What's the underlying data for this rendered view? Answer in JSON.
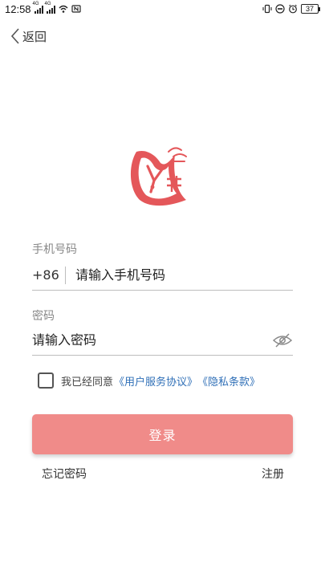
{
  "status_bar": {
    "time": "12:58",
    "network_1": "4G",
    "network_2": "4G",
    "battery": "37"
  },
  "nav": {
    "back_label": "返回"
  },
  "form": {
    "phone_label": "手机号码",
    "country_code": "+86",
    "phone_placeholder": "请输入手机号码",
    "password_label": "密码",
    "password_placeholder": "请输入密码"
  },
  "agreement": {
    "prefix": "我已经同意",
    "user_agreement": "《用户服务协议》",
    "privacy_policy": "《隐私条款》"
  },
  "actions": {
    "login": "登录",
    "forgot_password": "忘记密码",
    "register": "注册"
  },
  "colors": {
    "accent": "#f08b89",
    "logo": "#e4575a",
    "link": "#2f6fb7"
  }
}
